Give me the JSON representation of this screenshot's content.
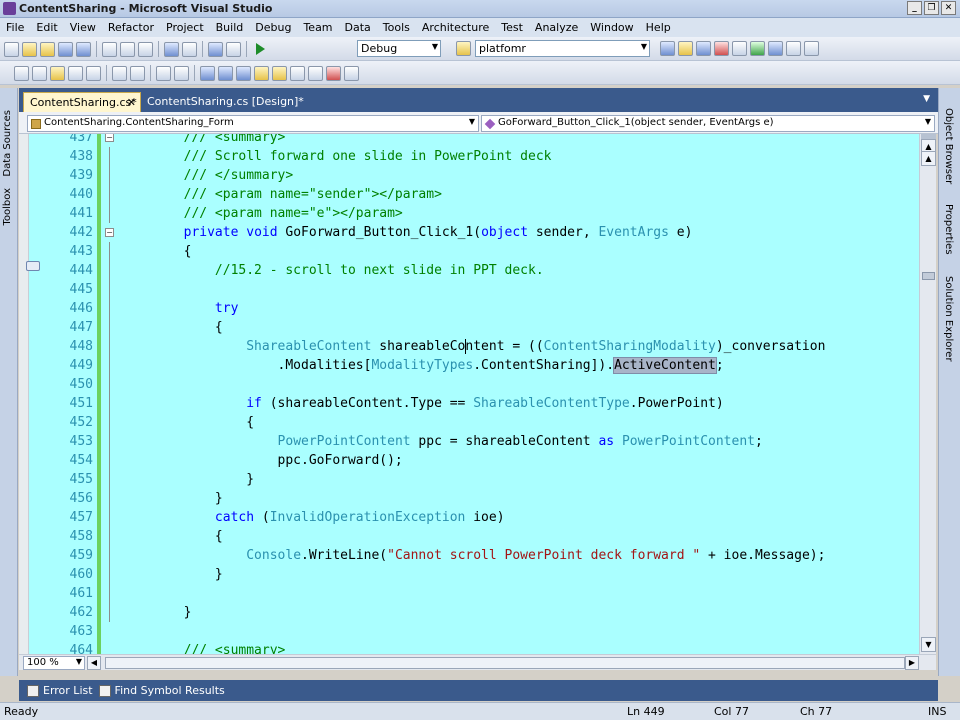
{
  "window": {
    "title": "ContentSharing - Microsoft Visual Studio"
  },
  "menu": [
    "File",
    "Edit",
    "View",
    "Refactor",
    "Project",
    "Build",
    "Debug",
    "Team",
    "Data",
    "Tools",
    "Architecture",
    "Test",
    "Analyze",
    "Window",
    "Help"
  ],
  "toolbar": {
    "config": "Debug",
    "platform": "platfomr"
  },
  "left_rail": [
    "Data Sources",
    "Toolbox"
  ],
  "right_rail": [
    "Object Browser",
    "Properties",
    "Solution Explorer"
  ],
  "tabs": [
    {
      "label": "ContentSharing.cs*",
      "active": true
    },
    {
      "label": "ContentSharing.cs [Design]*",
      "active": false
    }
  ],
  "nav": {
    "class_combo": "ContentSharing.ContentSharing_Form",
    "member_combo": "GoForward_Button_Click_1(object sender, EventArgs e)"
  },
  "code_lines": [
    {
      "num": "437",
      "tokens": [
        {
          "t": "        /// <summary>",
          "c": "com"
        }
      ]
    },
    {
      "num": "438",
      "tokens": [
        {
          "t": "        /// Scroll forward one slide in PowerPoint deck",
          "c": "com"
        }
      ]
    },
    {
      "num": "439",
      "tokens": [
        {
          "t": "        /// </summary>",
          "c": "com"
        }
      ]
    },
    {
      "num": "440",
      "tokens": [
        {
          "t": "        /// <param name=\"sender\"></param>",
          "c": "com"
        }
      ]
    },
    {
      "num": "441",
      "tokens": [
        {
          "t": "        /// <param name=\"e\"></param>",
          "c": "com"
        }
      ]
    },
    {
      "num": "442",
      "tokens": [
        {
          "t": "        "
        },
        {
          "t": "private",
          "c": "kw"
        },
        {
          "t": " "
        },
        {
          "t": "void",
          "c": "kw"
        },
        {
          "t": " GoForward_Button_Click_1("
        },
        {
          "t": "object",
          "c": "kw"
        },
        {
          "t": " sender, "
        },
        {
          "t": "EventArgs",
          "c": "type"
        },
        {
          "t": " e)"
        }
      ]
    },
    {
      "num": "443",
      "tokens": [
        {
          "t": "        {"
        }
      ]
    },
    {
      "num": "444",
      "tokens": [
        {
          "t": "            //15.2 - scroll to next slide in PPT deck.",
          "c": "com"
        }
      ]
    },
    {
      "num": "445",
      "tokens": [
        {
          "t": ""
        }
      ]
    },
    {
      "num": "446",
      "tokens": [
        {
          "t": "            "
        },
        {
          "t": "try",
          "c": "kw"
        }
      ]
    },
    {
      "num": "447",
      "tokens": [
        {
          "t": "            {"
        }
      ]
    },
    {
      "num": "448",
      "tokens": [
        {
          "t": "                "
        },
        {
          "t": "ShareableContent",
          "c": "type"
        },
        {
          "t": " shareableContent = (("
        },
        {
          "t": "ContentSharingModality",
          "c": "type"
        },
        {
          "t": ")_conversation"
        }
      ]
    },
    {
      "num": "449",
      "tokens": [
        {
          "t": "                    .Modalities["
        },
        {
          "t": "ModalityTypes",
          "c": "type"
        },
        {
          "t": ".ContentSharing])."
        },
        {
          "t": "ActiveContent",
          "c": "sel"
        },
        {
          "t": ";"
        }
      ]
    },
    {
      "num": "450",
      "tokens": [
        {
          "t": ""
        }
      ]
    },
    {
      "num": "451",
      "tokens": [
        {
          "t": "                "
        },
        {
          "t": "if",
          "c": "kw"
        },
        {
          "t": " (shareableContent.Type == "
        },
        {
          "t": "ShareableContentType",
          "c": "type"
        },
        {
          "t": ".PowerPoint)"
        }
      ]
    },
    {
      "num": "452",
      "tokens": [
        {
          "t": "                {"
        }
      ]
    },
    {
      "num": "453",
      "tokens": [
        {
          "t": "                    "
        },
        {
          "t": "PowerPointContent",
          "c": "type"
        },
        {
          "t": " ppc = shareableContent "
        },
        {
          "t": "as",
          "c": "kw"
        },
        {
          "t": " "
        },
        {
          "t": "PowerPointContent",
          "c": "type"
        },
        {
          "t": ";"
        }
      ]
    },
    {
      "num": "454",
      "tokens": [
        {
          "t": "                    ppc.GoForward();"
        }
      ]
    },
    {
      "num": "455",
      "tokens": [
        {
          "t": "                }"
        }
      ]
    },
    {
      "num": "456",
      "tokens": [
        {
          "t": "            }"
        }
      ]
    },
    {
      "num": "457",
      "tokens": [
        {
          "t": "            "
        },
        {
          "t": "catch",
          "c": "kw"
        },
        {
          "t": " ("
        },
        {
          "t": "InvalidOperationException",
          "c": "type"
        },
        {
          "t": " ioe)"
        }
      ]
    },
    {
      "num": "458",
      "tokens": [
        {
          "t": "            {"
        }
      ]
    },
    {
      "num": "459",
      "tokens": [
        {
          "t": "                "
        },
        {
          "t": "Console",
          "c": "type"
        },
        {
          "t": ".WriteLine("
        },
        {
          "t": "\"Cannot scroll PowerPoint deck forward \"",
          "c": "str"
        },
        {
          "t": " + ioe.Message);"
        }
      ]
    },
    {
      "num": "460",
      "tokens": [
        {
          "t": "            }"
        }
      ]
    },
    {
      "num": "461",
      "tokens": [
        {
          "t": ""
        }
      ]
    },
    {
      "num": "462",
      "tokens": [
        {
          "t": "        }"
        }
      ]
    },
    {
      "num": "463",
      "tokens": [
        {
          "t": ""
        }
      ]
    },
    {
      "num": "464",
      "tokens": [
        {
          "t": "        /// <summary>",
          "c": "com"
        }
      ]
    }
  ],
  "editor": {
    "zoom": "100 %"
  },
  "bottom_tabs": [
    "Error List",
    "Find Symbol Results"
  ],
  "status": {
    "state": "Ready",
    "ln": "Ln 449",
    "col": "Col 77",
    "ch": "Ch 77",
    "mode": "INS"
  },
  "colors": {
    "editor_bg": "#aaffff",
    "comment": "#008000",
    "keyword": "#0000ff",
    "type": "#2b91af",
    "string": "#a31515"
  }
}
